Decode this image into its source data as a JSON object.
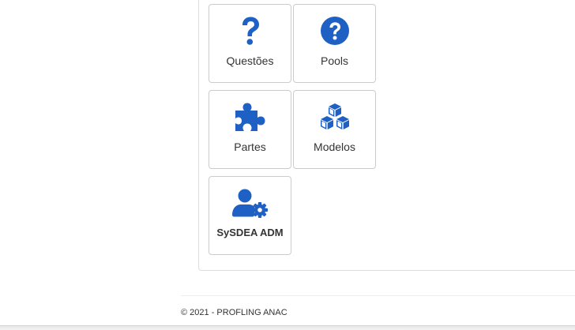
{
  "tiles": [
    {
      "label": "Questões",
      "icon": "question-icon"
    },
    {
      "label": "Pools",
      "icon": "question-circle-icon"
    },
    {
      "label": "Partes",
      "icon": "puzzle-piece-icon"
    },
    {
      "label": "Modelos",
      "icon": "cubes-icon"
    },
    {
      "label": "SySDEA ADM",
      "icon": "user-cog-icon"
    }
  ],
  "footer": {
    "text": "© 2021 - PROFLING ANAC"
  },
  "colors": {
    "icon_blue": "#1f60c4",
    "tile_border": "#cccccc",
    "text": "#333333"
  }
}
